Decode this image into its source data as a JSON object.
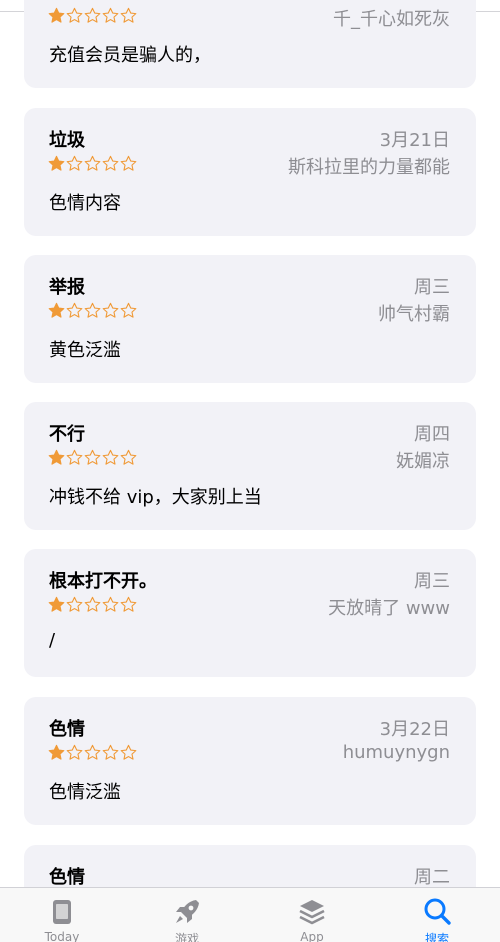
{
  "colors": {
    "star": "#f09a37",
    "accent": "#0a7aff",
    "muted": "#8e8e93",
    "card": "#f2f2f7"
  },
  "reviews": [
    {
      "title": "",
      "date": "",
      "author": "千_千心如死灰",
      "rating": 1,
      "body": "充值会员是骗人的，"
    },
    {
      "title": "垃圾",
      "date": "3月21日",
      "author": "斯科拉里的力量都能",
      "rating": 1,
      "body": "色情内容"
    },
    {
      "title": "举报",
      "date": "周三",
      "author": "帅气村霸",
      "rating": 1,
      "body": "黄色泛滥"
    },
    {
      "title": "不行",
      "date": "周四",
      "author": "妩媚凉",
      "rating": 1,
      "body": "冲钱不给 vip，大家别上当"
    },
    {
      "title": "根本打不开。",
      "date": "周三",
      "author": "天放晴了 www",
      "rating": 1,
      "body": " /"
    },
    {
      "title": "色情",
      "date": "3月22日",
      "author": "humuynygn",
      "rating": 1,
      "body": "色情泛滥"
    },
    {
      "title": "色情",
      "date": "周二",
      "author": "",
      "rating": 1,
      "body": ""
    }
  ],
  "tabbar": {
    "tabs": [
      {
        "label": "Today",
        "icon": "today-icon"
      },
      {
        "label": "游戏",
        "icon": "rocket-icon"
      },
      {
        "label": "App",
        "icon": "apps-stack-icon"
      },
      {
        "label": "搜索",
        "icon": "search-icon",
        "active": true
      }
    ]
  }
}
